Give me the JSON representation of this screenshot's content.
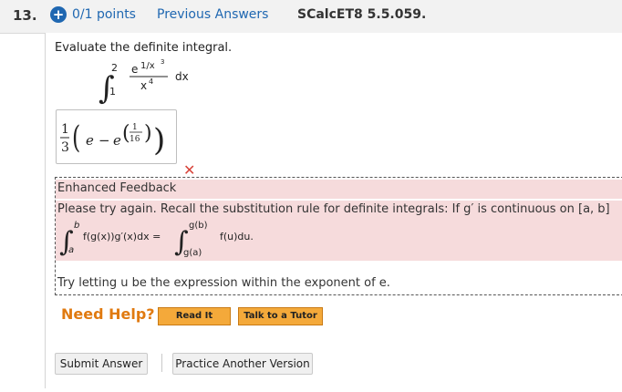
{
  "header": {
    "question_number": "13.",
    "points": "0/1 points",
    "previous_answers": "Previous Answers",
    "problem_code": "SCalcET8 5.5.059."
  },
  "question": {
    "prompt": "Evaluate the definite integral.",
    "integral": {
      "lower": "1",
      "upper": "2",
      "numerator": "e",
      "exponent": "1/x",
      "exponent_power": "3",
      "denominator": "x",
      "denominator_power": "4",
      "differential": "dx"
    }
  },
  "answer": {
    "coef_num": "1",
    "coef_den": "3",
    "term1": "e",
    "minus": "−",
    "term2": "e",
    "exp_num": "1",
    "exp_den": "16",
    "status": "incorrect"
  },
  "feedback": {
    "title": "Enhanced Feedback",
    "message": "Please try again. Recall the substitution rule for definite integrals: If g′ is continuous on [a, b]",
    "rule": {
      "upper": "b",
      "lower": "a",
      "lhs": "f(g(x))g′(x)dx =",
      "upper2": "g(b)",
      "lower2": "g(a)",
      "rhs": "f(u)du."
    },
    "hint": "Try letting u be the expression within the exponent of e."
  },
  "help": {
    "label": "Need Help?",
    "read_it": "Read It",
    "talk_to_tutor": "Talk to a Tutor"
  },
  "actions": {
    "submit": "Submit Answer",
    "practice": "Practice Another Version"
  },
  "colors": {
    "link_blue": "#1f67b1",
    "error_red": "#d8453b",
    "feedback_bg": "#f6dbdc",
    "help_orange": "#e07a10",
    "button_orange": "#f4a93a"
  }
}
